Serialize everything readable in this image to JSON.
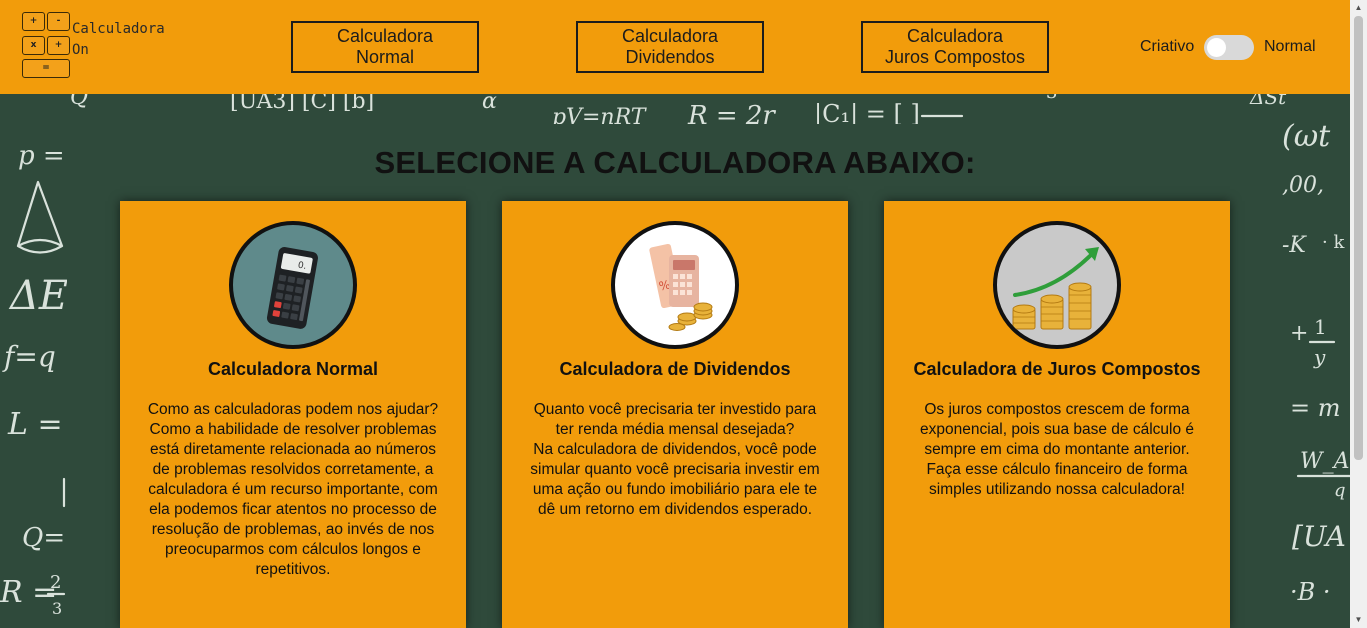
{
  "logo": {
    "keys": [
      "+",
      "-",
      "x",
      "+",
      "="
    ],
    "text": "Calculadora\nOn"
  },
  "nav": {
    "btn1": [
      "Calculadora",
      "Normal"
    ],
    "btn2": [
      "Calculadora",
      "Dividendos"
    ],
    "btn3": [
      "Calculadora",
      "Juros Compostos"
    ]
  },
  "toggle": {
    "left": "Criativo",
    "right": "Normal",
    "state": "off"
  },
  "main": {
    "title": "SELECIONE A CALCULADORA ABAIXO:"
  },
  "cards": [
    {
      "title": "Calculadora Normal",
      "text": "Como as calculadoras podem nos ajudar?\nComo a habilidade de resolver problemas está diretamente relacionada ao números de problemas resolvidos corretamente, a calculadora é um recurso importante, com ela podemos ficar atentos no processo de resolução de problemas, ao invés de nos preocuparmos com cálculos longos e repetitivos.",
      "icon": "calculator-icon",
      "img_bg": "#5f8a8b"
    },
    {
      "title": "Calculadora de Dividendos",
      "text": "Quanto você precisaria ter investido para ter renda média mensal desejada?\nNa calculadora de dividendos, você pode simular quanto você precisaria investir em uma ação ou fundo imobiliário para ele te dê um retorno em dividendos esperado.",
      "icon": "dividend-calculator-icon",
      "img_bg": "#ffffff"
    },
    {
      "title": "Calculadora de Juros Compostos",
      "text": "Os juros compostos crescem de forma exponencial, pois sua base de cálculo é sempre em cima do montante anterior. Faça esse cálculo financeiro de forma simples utilizando nossa calculadora!",
      "icon": "coins-growth-icon",
      "img_bg": "#c9c9c9"
    }
  ],
  "colors": {
    "accent": "#f29c0b",
    "board": "#2f4a3b",
    "ink": "#111111"
  }
}
